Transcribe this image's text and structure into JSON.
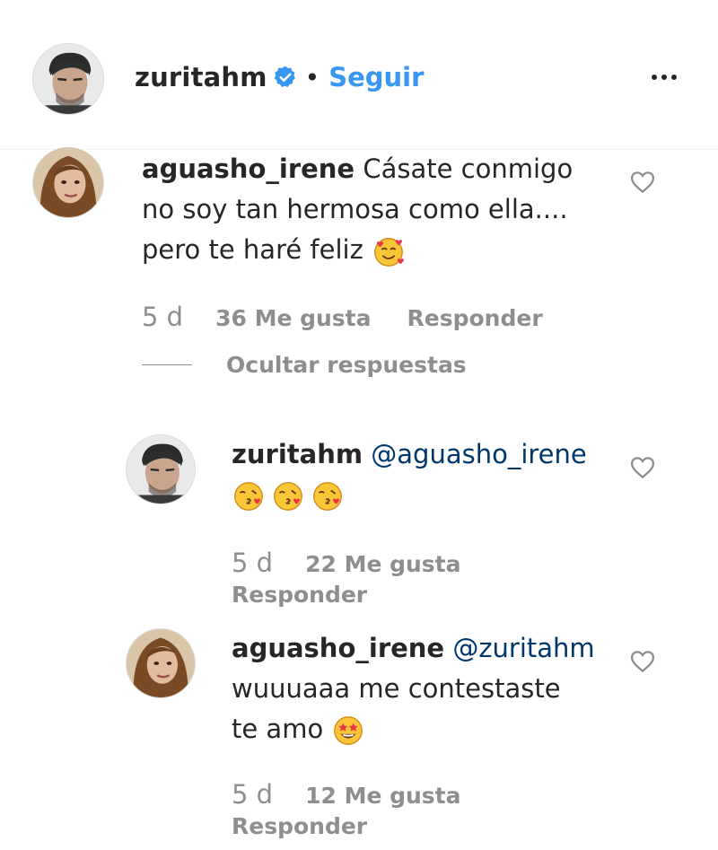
{
  "post_header": {
    "username": "zuritahm",
    "separator": "•",
    "follow_label": "Seguir",
    "verified_icon": "verified-badge-icon",
    "more_icon": "more-options-icon"
  },
  "comments": [
    {
      "username": "aguasho_irene",
      "text_line1": "Cásate conmigo",
      "text_line2": "no soy tan hermosa como ella....",
      "text_line3": "pero te haré feliz",
      "emoji": "smiling-face-with-hearts",
      "time": "5 d",
      "likes": "36 Me gusta",
      "reply_label": "Responder",
      "hide_replies_label": "Ocultar respuestas"
    },
    {
      "username": "zuritahm",
      "mention": "@aguasho_irene",
      "emojis": [
        "face-blowing-kiss",
        "face-blowing-kiss",
        "face-blowing-kiss"
      ],
      "time": "5 d",
      "likes": "22 Me gusta",
      "reply_label": "Responder"
    },
    {
      "username": "aguasho_irene",
      "mention": "@zuritahm",
      "text_line1": "wuuuaaa me contestaste",
      "text_line2": "te amo",
      "emoji": "star-struck",
      "time": "5 d",
      "likes": "12 Me gusta",
      "reply_label": "Responder"
    }
  ],
  "colors": {
    "link_blue": "#3897f0",
    "mention_blue": "#00376b",
    "muted": "#8e8e8e",
    "text": "#262626"
  }
}
